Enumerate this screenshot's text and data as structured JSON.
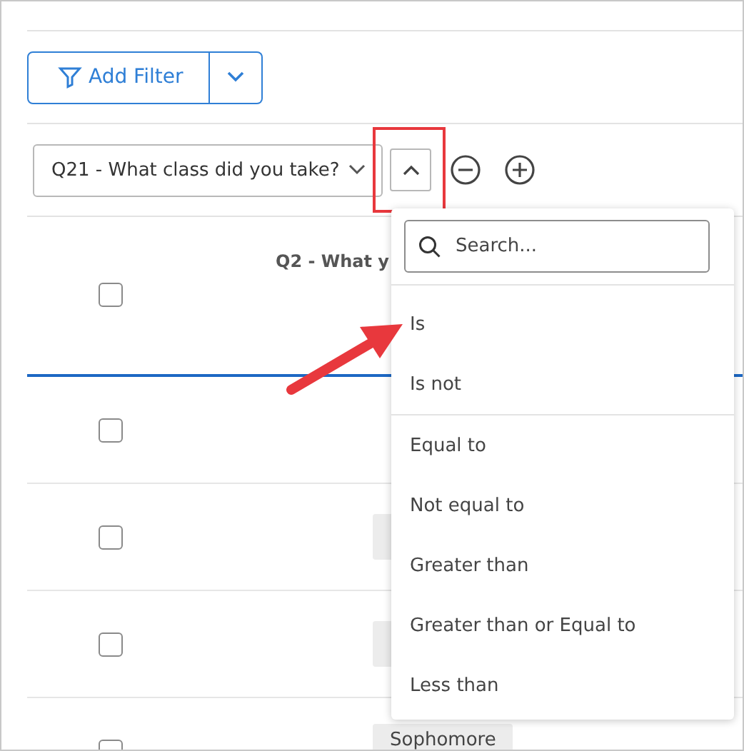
{
  "toolbar": {
    "add_filter": "Add Filter"
  },
  "filter": {
    "question": "Q21 - What class did you take?",
    "operator_open": true,
    "highlighted": true
  },
  "table": {
    "header": "Q2 - What y",
    "header_checked": false,
    "rows": [
      {
        "checked": false,
        "tag": null
      },
      {
        "checked": false,
        "tag": ""
      },
      {
        "checked": false,
        "tag": ""
      },
      {
        "checked": false,
        "tag": "Sophomore"
      }
    ]
  },
  "dropdown": {
    "search_placeholder": "Search...",
    "groups": [
      [
        "Is",
        "Is not"
      ],
      [
        "Equal to",
        "Not equal to",
        "Greater than",
        "Greater than or Equal to",
        "Less than"
      ]
    ]
  },
  "annotation": {
    "kind": "arrow"
  }
}
